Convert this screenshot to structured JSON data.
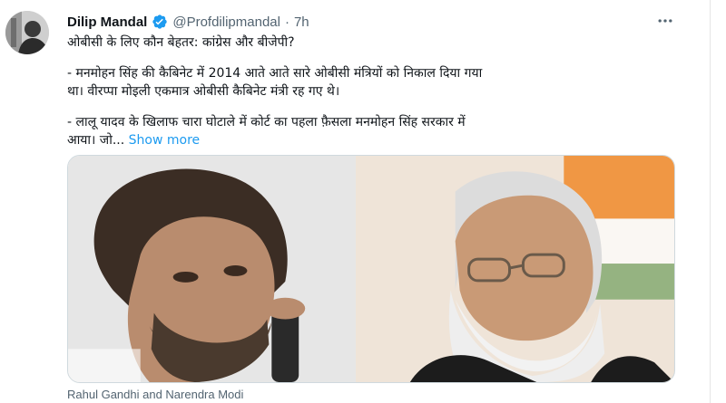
{
  "tweet": {
    "display_name": "Dilip Mandal",
    "handle": "@Profdilipmandal",
    "separator": "·",
    "time": "7h",
    "verified_icon": "verified-badge-icon",
    "more_icon": "more-horizontal-icon",
    "text": {
      "line1": "ओबीसी के लिए कौन बेहतर: कांग्रेस और बीजेपी?",
      "para2_line1": "- मनमोहन सिंह की कैबिनेट में 2014 आते आते सारे ओबीसी मंत्रियों को निकाल दिया गया",
      "para2_line2": "था। वीरप्पा मोइली एकमात्र ओबीसी कैबिनेट मंत्री रह गए थे।",
      "para3_line1": "- लालू यादव के खिलाफ चारा घोटाले में कोर्ट का पहला फ़ैसला मनमोहन सिंह सरकार में",
      "para3_line2": "आया। जो...",
      "show_more": "Show more"
    },
    "media_caption": "Rahul Gandhi and Narendra Modi",
    "colors": {
      "link": "#1d9bf0",
      "verified": "#1d9bf0",
      "secondary_text": "#536471"
    }
  }
}
